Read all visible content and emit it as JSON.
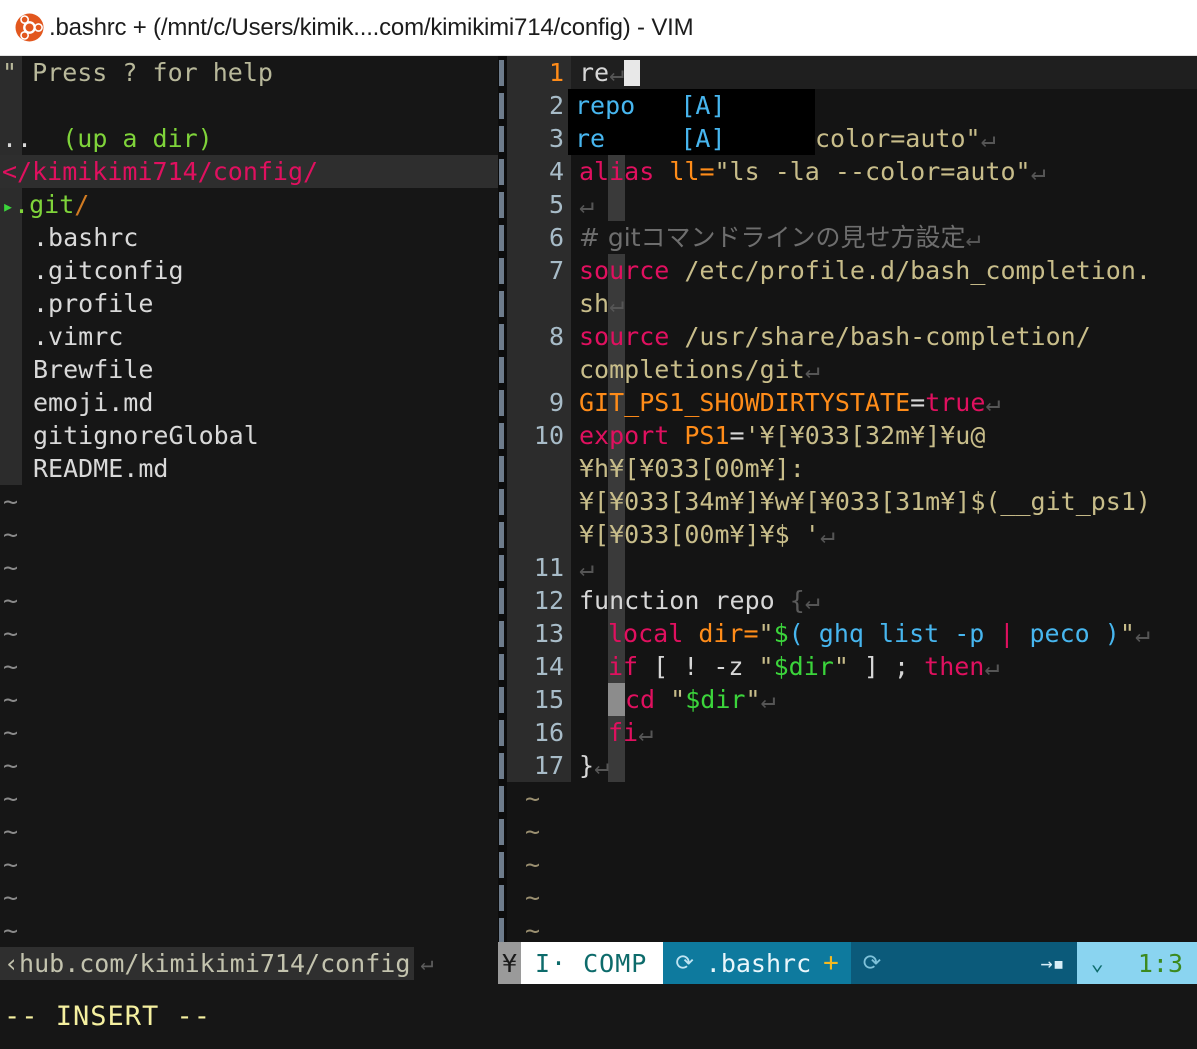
{
  "window": {
    "title": ".bashrc + (/mnt/c/Users/kimik....com/kimikimi714/config) - VIM",
    "icon": "ubuntu-logo"
  },
  "tree": {
    "help_line": "\" Press ? for help",
    "up_dir": "  (up a dir)",
    "up_dots": "..",
    "root_path": "</kimikimi714/config/",
    "dir_entry": {
      "arrow": "▸",
      "name": ".git",
      "slash": "/"
    },
    "files": [
      ".bashrc",
      ".gitconfig",
      ".profile",
      ".vimrc",
      "Brewfile",
      "emoji.md",
      "gitignoreGlobal",
      "README.md"
    ],
    "tilde": "~",
    "tilde_count": 14
  },
  "editor": {
    "lines": [
      {
        "num": "1",
        "text": "re"
      },
      {
        "num": "2",
        "text": ""
      },
      {
        "num": "3",
        "text": "color=auto\""
      },
      {
        "num": "4",
        "text": "alias ll=\"ls -la --color=auto\""
      },
      {
        "num": "5",
        "text": ""
      },
      {
        "num": "6",
        "text": "# gitコマンドラインの見せ方設定"
      },
      {
        "num": "7",
        "text": "source /etc/profile.d/bash_completion.sh"
      },
      {
        "num": "8",
        "text": "source /usr/share/bash-completion/completions/git"
      },
      {
        "num": "9",
        "text": "GIT_PS1_SHOWDIRTYSTATE=true"
      },
      {
        "num": "10",
        "text": "export PS1='¥[¥033[32m¥]¥u@¥h¥[¥033[00m¥]:¥[¥033[34m¥]¥w¥[¥033[31m¥]$(__git_ps1)¥[¥033[00m¥]¥$ '"
      },
      {
        "num": "11",
        "text": ""
      },
      {
        "num": "12",
        "text": "function repo {"
      },
      {
        "num": "13",
        "text": "  local dir=\"$( ghq list -p | peco )\""
      },
      {
        "num": "14",
        "text": "  if [ ! -z \"$dir\" ] ; then"
      },
      {
        "num": "15",
        "text": "    cd \"$dir\""
      },
      {
        "num": "16",
        "text": "  fi"
      },
      {
        "num": "17",
        "text": "}"
      }
    ],
    "line7_wrap": "sh",
    "line8_wrap": "completions/git",
    "line10_wrap_1": "¥h¥[¥033[00m¥]:",
    "line10_wrap_2": "¥[¥033[34m¥]¥w¥[¥033[31m¥]$(__git_ps1)",
    "line10_wrap_3": "¥[¥033[00m¥]¥$ '",
    "eol_glyph": "↵",
    "tilde": "~",
    "tilde_count": 5
  },
  "popup": {
    "items": [
      {
        "word": "repo",
        "kind": "[A]"
      },
      {
        "word": "re",
        "kind": "[A]"
      }
    ]
  },
  "status_left": {
    "path": "‹hub.com/kimikimi714/config",
    "eol_glyph": "↵"
  },
  "status_right": {
    "encoding_glyph": "¥",
    "mode": "I·",
    "completion": "COMP",
    "branch_glyph": "⟳",
    "filename": ".bashrc",
    "modified_flag": "+",
    "mid_branch_glyph": "⟳",
    "tab_glyph": "→▪",
    "chevron_glyph": "⌄",
    "position": "1:3"
  },
  "message": {
    "text": "-- INSERT --"
  },
  "colors": {
    "accent_orange": "#ff8c19",
    "accent_pink": "#e0105f",
    "accent_cyan": "#47b6ef",
    "accent_green": "#3bd43b",
    "string_tan": "#c8bd8a",
    "status_teal": "#0e7a9e",
    "status_lightblue": "#8ad4f0",
    "title_bg": "#ffffff",
    "editor_bg": "#141414",
    "tree_bg": "#161616"
  }
}
